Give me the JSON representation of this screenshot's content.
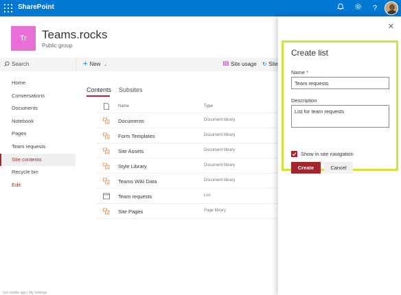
{
  "suite": {
    "brand": "SharePoint"
  },
  "site": {
    "logo_text": "Tr",
    "title": "Teams.rocks",
    "subtitle": "Public group",
    "logo_color": "#e86fd8"
  },
  "command_bar": {
    "search": "Search",
    "new": "New",
    "site_usage": "Site usage",
    "site_more": "Site c"
  },
  "nav": {
    "items": [
      {
        "label": "Home"
      },
      {
        "label": "Conversations"
      },
      {
        "label": "Documents"
      },
      {
        "label": "Notebook"
      },
      {
        "label": "Pages"
      },
      {
        "label": "Team requests"
      },
      {
        "label": "Site contents"
      },
      {
        "label": "Recycle bin"
      },
      {
        "label": "Edit"
      }
    ],
    "active": "Site contents"
  },
  "tabs": {
    "contents": "Contents",
    "subsites": "Subsites"
  },
  "list": {
    "columns": {
      "name": "Name",
      "type": "Type"
    },
    "rows": [
      {
        "name": "Documents",
        "type": "Document library",
        "icon": "library-icon"
      },
      {
        "name": "Form Templates",
        "type": "Document library",
        "icon": "library-icon"
      },
      {
        "name": "Site Assets",
        "type": "Document library",
        "icon": "library-icon"
      },
      {
        "name": "Style Library",
        "type": "Document library",
        "icon": "library-icon"
      },
      {
        "name": "Teams Wiki Data",
        "type": "Document library",
        "icon": "library-icon"
      },
      {
        "name": "Team requests",
        "type": "List",
        "icon": "list-icon"
      },
      {
        "name": "Site Pages",
        "type": "Page library",
        "icon": "library-icon"
      }
    ]
  },
  "panel": {
    "title": "Create list",
    "name_label": "Name",
    "name_required": "*",
    "name_value": "Team requests",
    "description_label": "Description",
    "description_value": "List for team requests",
    "show_in_nav_label": "Show in site navigation",
    "show_in_nav_checked": true,
    "create_label": "Create",
    "cancel_label": "Cancel"
  },
  "colors": {
    "suite_bar": "#0078d4",
    "accent": "#a4262c",
    "highlight": "#d2e23b"
  },
  "footer": "Get mobile app | My Settings"
}
